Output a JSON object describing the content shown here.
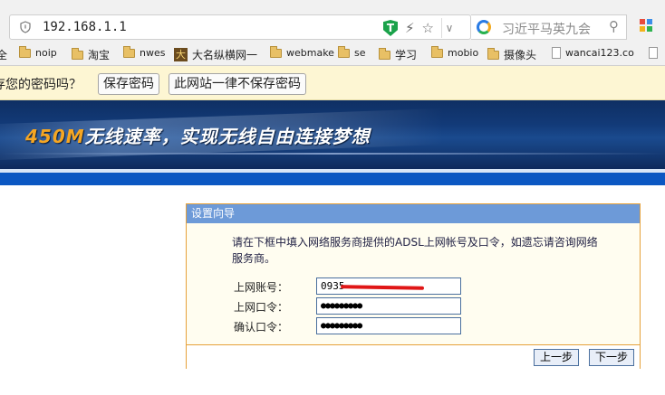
{
  "browser": {
    "url": "192.168.1.1",
    "search_text": "习近平马英九会",
    "ext_badge": "T",
    "extra_glyph": "⚡"
  },
  "bookmarks": [
    {
      "label": "全",
      "icon": "none"
    },
    {
      "label": "noip",
      "icon": "folder"
    },
    {
      "label": "淘宝",
      "icon": "folder"
    },
    {
      "label": "nwes",
      "icon": "folder"
    },
    {
      "label": "大名纵横网一",
      "icon": "da",
      "icon_text": "大"
    },
    {
      "label": "webmake",
      "icon": "folder"
    },
    {
      "label": "se",
      "icon": "folder"
    },
    {
      "label": "学习",
      "icon": "folder"
    },
    {
      "label": "mobio",
      "icon": "folder"
    },
    {
      "label": "摄像头",
      "icon": "folder"
    },
    {
      "label": "wancai123.co",
      "icon": "page"
    },
    {
      "label": "",
      "icon": "page"
    }
  ],
  "infobar": {
    "prompt": "存您的密码吗？",
    "save_label": "保存密码",
    "never_label": "此网站一律不保存密码"
  },
  "banner": {
    "speed": "450M",
    "slogan": "无线速率，实现无线自由连接梦想"
  },
  "wizard": {
    "title": "设置向导",
    "description": "请在下框中填入网络服务商提供的ADSL上网帐号及口令，如遗忘请咨询网络服务商。",
    "fields": [
      {
        "label": "上网账号：",
        "value": "0935"
      },
      {
        "label": "上网口令：",
        "value": "●●●●●●●●●"
      },
      {
        "label": "确认口令：",
        "value": "●●●●●●●●●"
      }
    ],
    "prev_label": "上一步",
    "next_label": "下一步"
  },
  "colors": {
    "banner_accent": "#f5a623",
    "wizard_header": "#6d9ad8",
    "wizard_border": "#e6a13a",
    "infobar_bg": "#fdf6d3",
    "redaction": "#e01616"
  }
}
